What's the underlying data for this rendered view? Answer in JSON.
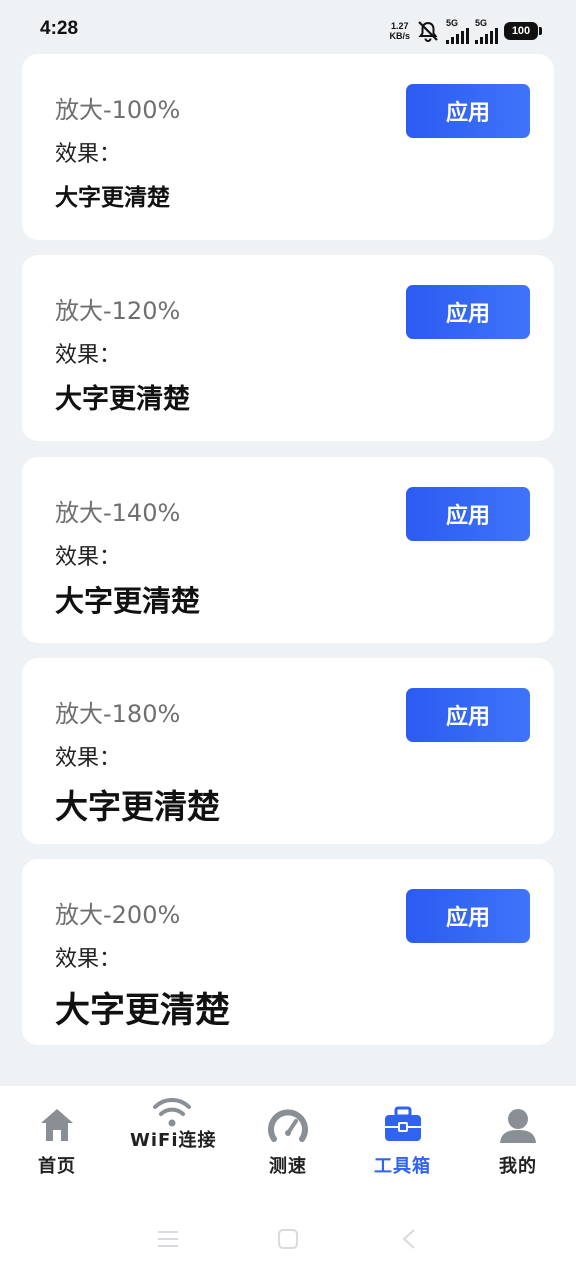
{
  "status": {
    "time": "4:28",
    "speed_value": "1.27",
    "speed_unit": "KB/s",
    "sim1": "5G",
    "sim2": "5G",
    "battery": "100"
  },
  "cards": [
    {
      "zoom": "放大-100%",
      "effect_label": "效果：",
      "sample": "大字更清楚",
      "button": "应用"
    },
    {
      "zoom": "放大-120%",
      "effect_label": "效果：",
      "sample": "大字更清楚",
      "button": "应用"
    },
    {
      "zoom": "放大-140%",
      "effect_label": "效果：",
      "sample": "大字更清楚",
      "button": "应用"
    },
    {
      "zoom": "放大-180%",
      "effect_label": "效果：",
      "sample": "大字更清楚",
      "button": "应用"
    },
    {
      "zoom": "放大-200%",
      "effect_label": "效果：",
      "sample": "大字更清楚",
      "button": "应用"
    }
  ],
  "tabs": [
    {
      "label": "首页",
      "icon": "home-icon"
    },
    {
      "label": "WiFi连接",
      "icon": "wifi-icon"
    },
    {
      "label": "测速",
      "icon": "speedometer-icon"
    },
    {
      "label": "工具箱",
      "icon": "toolbox-icon",
      "active": true
    },
    {
      "label": "我的",
      "icon": "user-icon"
    }
  ],
  "colors": {
    "accent": "#2f63f0",
    "background": "#eef2f5",
    "icon_gray": "#8a8f96"
  }
}
